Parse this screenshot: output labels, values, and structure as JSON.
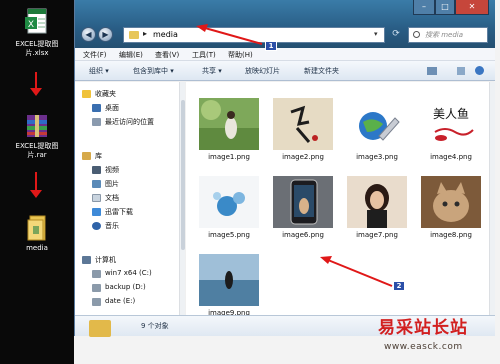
{
  "desktop": {
    "icons": [
      {
        "label_line1": "EXCEL提取图",
        "label_line2": "片.xlsx",
        "icon": "excel-file-icon"
      },
      {
        "label_line1": "EXCEL提取图",
        "label_line2": "片.rar",
        "icon": "rar-archive-icon"
      },
      {
        "label_line1": "media",
        "label_line2": "",
        "icon": "folder-icon"
      }
    ]
  },
  "window": {
    "address": {
      "path": "media",
      "separator": "▸"
    },
    "search_placeholder": "搜索 media",
    "menu": [
      "文件(F)",
      "编辑(E)",
      "查看(V)",
      "工具(T)",
      "帮助(H)"
    ],
    "toolbar": [
      "组织 ▾",
      "包含到库中 ▾",
      "共享 ▾",
      "放映幻灯片",
      "新建文件夹"
    ],
    "navpane": {
      "favorites_header": "收藏夹",
      "favorites": [
        "桌面",
        "最近访问的位置"
      ],
      "libraries_header": "库",
      "libraries": [
        "视频",
        "图片",
        "文档",
        "迅雷下载",
        "音乐"
      ],
      "computer_header": "计算机",
      "drives": [
        "win7 x64 (C:)",
        "backup (D:)",
        "date (E:)"
      ]
    },
    "files": [
      {
        "name": "image1.png"
      },
      {
        "name": "image2.png"
      },
      {
        "name": "image3.png"
      },
      {
        "name": "image4.png"
      },
      {
        "name": "image5.png"
      },
      {
        "name": "image6.png"
      },
      {
        "name": "image7.png"
      },
      {
        "name": "image8.png"
      },
      {
        "name": "image9.png"
      }
    ],
    "details": {
      "count": "9 个对象"
    }
  },
  "annotations": {
    "badge1": "1",
    "badge2": "2"
  },
  "watermark": {
    "title": "易采站长站",
    "url": "www.easck.com"
  },
  "colors": {
    "arrow": "#e01818",
    "badge": "#2b4fa8",
    "titlebar": "#2c6490"
  }
}
